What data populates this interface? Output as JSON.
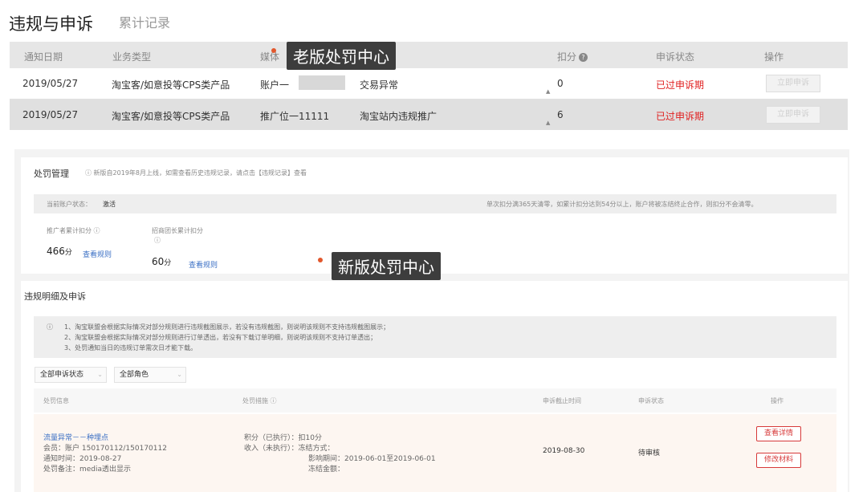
{
  "header": {
    "title": "违规与申诉",
    "tab_records": "累计记录"
  },
  "old_table": {
    "columns": [
      "通知日期",
      "业务类型",
      "媒体",
      "扣分",
      "申诉状态",
      "操作"
    ],
    "rows": [
      {
        "date": "2019/05/27",
        "biz": "淘宝客/如意投等CPS类产品",
        "media": "账户一",
        "reason": "交易异常",
        "score": "0",
        "status": "已过申诉期",
        "action": "立即申诉"
      },
      {
        "date": "2019/05/27",
        "biz": "淘宝客/如意投等CPS类产品",
        "media": "推广位一11111",
        "reason": "淘宝站内违规推广",
        "score": "6",
        "status": "已过申诉期",
        "action": "立即申诉"
      }
    ]
  },
  "callouts": {
    "old": "老版处罚中心",
    "new": "新版处罚中心"
  },
  "penalty": {
    "title": "处罚管理",
    "note": "新版自2019年8月上线，如需查看历史违规记录，请点击【违规记录】查看",
    "status_label": "当前账户状态：",
    "status_value": "激活",
    "rule_note": "单次扣分满365天清零，如累计扣分达到54分以上，账户将被冻结终止合作，则扣分不会清零。",
    "promoter_label": "推广者累计扣分",
    "promoter_score": "466",
    "leader_label": "招商团长累计扣分",
    "leader_score": "60",
    "unit": "分",
    "view_rules": "查看规则"
  },
  "details": {
    "title": "违规明细及申诉",
    "notices": [
      "1、淘宝联盟会根据实际情况对部分规则进行违规截图展示，若没有违规截图，则说明该规则不支持违规截图展示；",
      "2、淘宝联盟会根据实际情况对部分规则进行订单透出，若没有下载订单明细，则说明该规则不支持订单透出；",
      "3、处罚通知当日的违规订单需次日才能下载。"
    ],
    "filter_status": "全部申诉状态",
    "filter_role": "全部角色",
    "columns": [
      "处罚信息",
      "处罚措施",
      "申诉截止时间",
      "申诉状态",
      "操作"
    ],
    "row": {
      "name": "流量异常－－种埋点",
      "member": "会员：账户 150170112/150170112",
      "notice_time": "通知时间：2019-08-27",
      "remark": "处罚备注：media透出显示",
      "measure1": "积分（已执行）：扣10分",
      "measure2": "收入（未执行）：冻结方式：",
      "measure3": "影响期间：2019-06-01至2019-06-01",
      "measure4": "冻结金额：",
      "deadline": "2019-08-30",
      "status": "待审核",
      "btn_detail": "查看详情",
      "btn_edit": "修改材料"
    }
  },
  "colors": {
    "accent": "#e02020",
    "link": "#3a6fc4",
    "callout_dot": "#e2572c"
  }
}
